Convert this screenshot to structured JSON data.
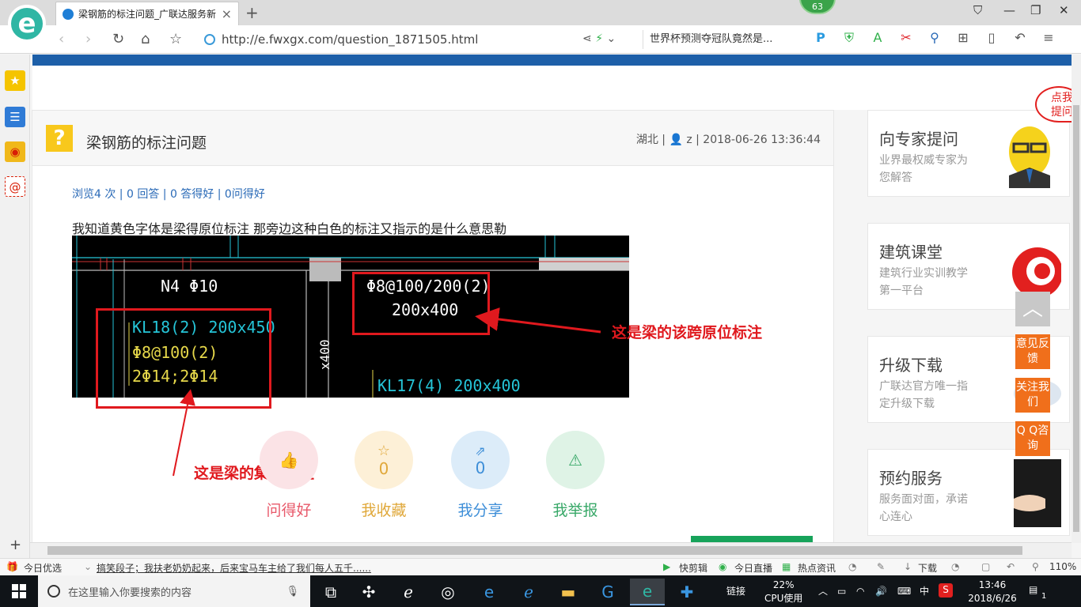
{
  "browser": {
    "tab_title": "梁钢筋的标注问题_广联达服务新",
    "tab_close": "×",
    "new_tab": "+",
    "notification_count": "63",
    "url": "http://e.fwxgx.com/question_1871505.html",
    "search_text": "世界杯预测夺冠队竟然是...",
    "icons": [
      "back-icon",
      "forward-icon",
      "refresh-icon",
      "home-icon",
      "star-icon",
      "share-icon",
      "lightning-icon",
      "search-icon",
      "extension-icons",
      "undo-icon",
      "menu-icon"
    ]
  },
  "sidebar_icons": [
    "favorites-icon",
    "reader-icon",
    "weibo-icon",
    "mail-icon"
  ],
  "question": {
    "icon": "?",
    "title": "梁钢筋的标注问题",
    "meta": "湖北 | 👤 z | 2018-06-26 13:36:44",
    "stats": "浏览4 次 | 0 回答 | 0 答得好 | 0问得好",
    "body": "我知道黄色字体是梁得原位标注   那旁边这种白色的标注又指示的是什么意思勒"
  },
  "cad_image": {
    "texts": {
      "n4": "N4 Φ10",
      "kl18": "KL18(2) 200x450",
      "stirrup1": "Φ8@100(2)",
      "bars": "2Φ14;2Φ14",
      "stirrup2": "Φ8@100/200(2)",
      "size2": "200x400",
      "kl17": "KL17(4) 200x400",
      "vertical": "x400"
    }
  },
  "annotations": {
    "right_label": "这是梁的该跨原位标注",
    "bottom_label": "这是梁的集中标注"
  },
  "actions": [
    {
      "label": "问得好",
      "count": "",
      "color": "#e8596a",
      "bg": "#fbe3e6",
      "icon": "thumbs-up-icon"
    },
    {
      "label": "我收藏",
      "count": "0",
      "color": "#e0a83a",
      "bg": "#fdf0d7",
      "icon": "star-icon"
    },
    {
      "label": "我分享",
      "count": "0",
      "color": "#3d8ed8",
      "bg": "#dcecf9",
      "icon": "share-icon"
    },
    {
      "label": "我举报",
      "count": "",
      "color": "#38a868",
      "bg": "#dff3e6",
      "icon": "warning-icon"
    }
  ],
  "right_cards": [
    {
      "title": "向专家提问",
      "sub": "业界最权威专家为您解答"
    },
    {
      "title": "建筑课堂",
      "sub": "建筑行业实训教学第一平台"
    },
    {
      "title": "升级下载",
      "sub": "广联达官方唯一指定升级下载"
    },
    {
      "title": "预约服务",
      "sub": "服务面对面，承诺心连心"
    }
  ],
  "corner_badge": "点我提问",
  "float_buttons": {
    "feedback": "意见反馈",
    "follow": "关注我们",
    "qq": "Q Q咨询"
  },
  "statusbar": {
    "today": "今日优选",
    "ticker": "搞笑段子；我扶老奶奶起来，后来宝马车主给了我们每人五千......",
    "video": "快剪辑",
    "live": "今日直播",
    "news": "热点资讯",
    "download": "下载",
    "zoom": "110%"
  },
  "taskbar": {
    "search_placeholder": "在这里输入你要搜索的内容",
    "link_label": "链接",
    "cpu_percent": "22%",
    "cpu_label": "CPU使用",
    "ime": "中",
    "time": "13:46",
    "date": "2018/6/26",
    "notification_count": "1"
  },
  "colors": {
    "brand_blue": "#1d5fa8",
    "annotation_red": "#e0191e",
    "cad_cyan": "#25c5d8",
    "cad_yellow": "#e6d84a",
    "cad_white": "#ffffff",
    "float_orange": "#f06f1b"
  }
}
